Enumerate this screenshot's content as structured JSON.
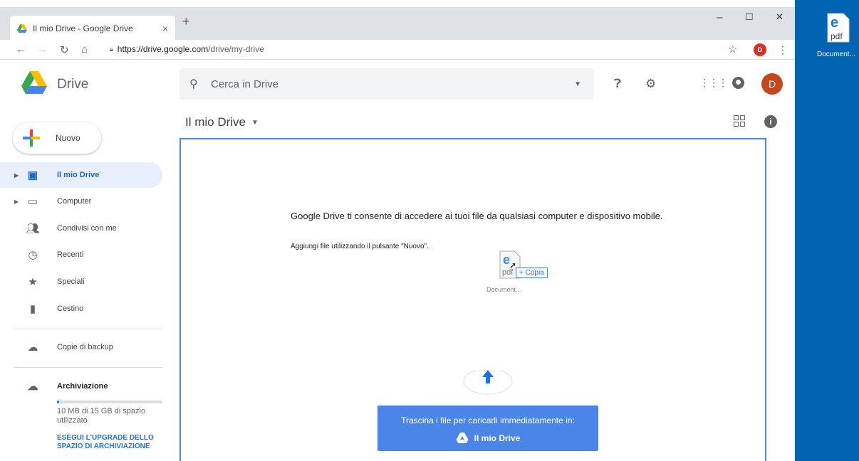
{
  "browser": {
    "tab_title": "Il mio Drive - Google Drive",
    "tab_close": "×",
    "new_tab": "+",
    "url_host": "https://drive.google.com",
    "url_path": "/drive/my-drive",
    "profile_initial": "D",
    "window_min": "–",
    "window_max": "☐",
    "window_close": "✕"
  },
  "header": {
    "app_name": "Drive",
    "search_placeholder": "Cerca in Drive",
    "avatar_initial": "D"
  },
  "sidebar": {
    "new_label": "Nuovo",
    "items": [
      {
        "label": "Il mio Drive",
        "icon": "my-drive-icon"
      },
      {
        "label": "Computer",
        "icon": "computer-icon"
      },
      {
        "label": "Condivisi con me",
        "icon": "shared-icon"
      },
      {
        "label": "Recenti",
        "icon": "clock-icon"
      },
      {
        "label": "Speciali",
        "icon": "star-icon"
      },
      {
        "label": "Cestino",
        "icon": "trash-icon"
      },
      {
        "label": "Copie di backup",
        "icon": "cloud-icon"
      },
      {
        "label": "Archiviazione",
        "icon": "cloud-outline-icon"
      }
    ],
    "storage_used_fraction": 0.01,
    "storage_text": "10 MB di 15 GB di spazio utilizzato",
    "upgrade_link": "ESEGUI L'UPGRADE DELLO SPAZIO DI ARCHIVIAZIONE"
  },
  "main": {
    "breadcrumb": "Il mio Drive",
    "empty_message": "Google Drive ti consente di accedere ai tuoi file da qualsiasi computer e dispositivo mobile.",
    "empty_sub": "Aggiungi file utilizzando il pulsante \"Nuovo\".",
    "drag_file_name": "Document...",
    "copy_tooltip": "+ Copia",
    "upload_text": "Trascina i file per caricarli immediatamente in:",
    "upload_target": "Il mio Drive"
  },
  "desktop": {
    "file_label": "Document...",
    "file_ext": "pdf"
  },
  "colors": {
    "accent": "#1a73e8",
    "dropzone_border": "#4a86e8",
    "desktop_bg": "#0063b1",
    "avatar_bg": "#c4461b"
  }
}
